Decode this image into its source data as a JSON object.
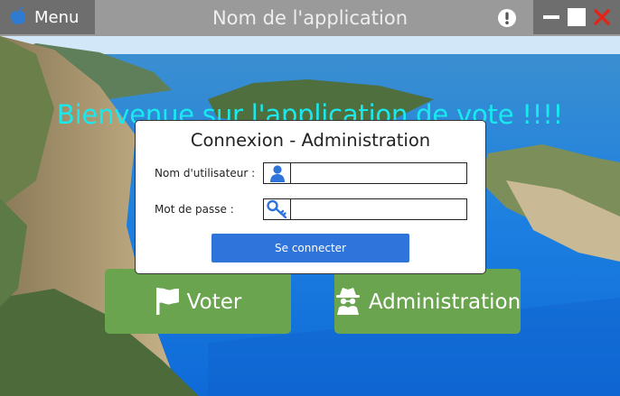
{
  "titlebar": {
    "menu_label": "Menu",
    "menu_icon": "apple-icon",
    "app_title": "Nom de l'application",
    "alert_icon": "exclamation-circle-icon",
    "controls": [
      "minimize-icon",
      "maximize-icon",
      "close-icon"
    ]
  },
  "welcome": {
    "text": "Bienvenue sur l'application de vote !!!!",
    "color": "#19e9ee"
  },
  "login": {
    "title": "Connexion - Administration",
    "username_label": "Nom d'utilisateur :",
    "username_value": "",
    "username_icon": "user-icon",
    "password_label": "Mot de passe :",
    "password_value": "",
    "password_icon": "key-icon",
    "submit_label": "Se connecter",
    "submit_color": "#2f74db"
  },
  "actions": {
    "voter_label": "Voter",
    "voter_icon": "flag-icon",
    "admin_label": "Administration",
    "admin_icon": "spy-icon",
    "button_color": "#6aa44f"
  }
}
